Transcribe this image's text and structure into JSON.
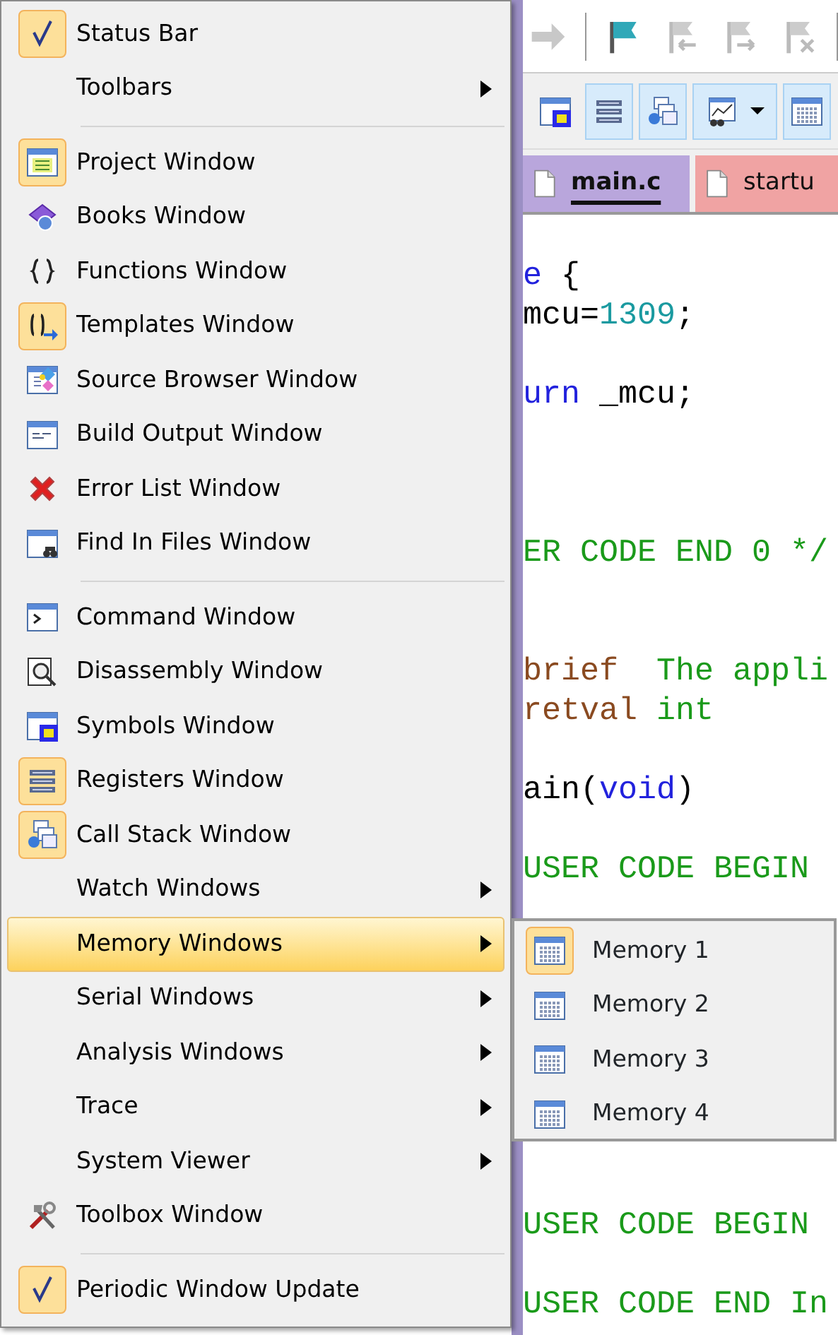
{
  "toolbar": {
    "buttons": [
      {
        "on": false
      },
      {
        "on": false
      },
      {
        "on": false
      },
      {
        "on": false
      },
      {
        "on": false
      }
    ]
  },
  "toolbar_2": {
    "buttons": [
      {
        "on": false
      },
      {
        "on": true
      },
      {
        "on": true
      },
      {
        "on": true
      },
      {
        "on": true
      }
    ]
  },
  "tabs": [
    {
      "label": "main.c",
      "selected": true,
      "color": "#b9a6dc"
    },
    {
      "label": "startu",
      "selected": false,
      "color": "#f0a3a3"
    }
  ],
  "code": {
    "lines": [
      {
        "kind": "code",
        "segments": [
          {
            "kind": "keyword",
            "text": "e"
          },
          {
            "kind": "plain",
            "text": " {"
          }
        ]
      },
      {
        "kind": "code",
        "segments": [
          {
            "kind": "plain",
            "text": "mcu="
          },
          {
            "kind": "number",
            "text": "1309"
          },
          {
            "kind": "plain",
            "text": ";"
          }
        ]
      },
      {
        "kind": "blank"
      },
      {
        "kind": "code",
        "segments": [
          {
            "kind": "keyword",
            "text": "urn"
          },
          {
            "kind": "plain",
            "text": " _mcu;"
          }
        ]
      },
      {
        "kind": "blank"
      },
      {
        "kind": "blank"
      },
      {
        "kind": "blank"
      },
      {
        "kind": "code",
        "segments": [
          {
            "kind": "comment",
            "text": "ER CODE END 0 */"
          }
        ]
      },
      {
        "kind": "blank"
      },
      {
        "kind": "blank"
      },
      {
        "kind": "code",
        "segments": [
          {
            "kind": "tag",
            "text": "brief"
          },
          {
            "kind": "comment",
            "text": "  The appli"
          }
        ]
      },
      {
        "kind": "code",
        "segments": [
          {
            "kind": "tag",
            "text": "retval"
          },
          {
            "kind": "comment",
            "text": " int"
          }
        ]
      },
      {
        "kind": "blank"
      },
      {
        "kind": "code",
        "segments": [
          {
            "kind": "plain",
            "text": "ain("
          },
          {
            "kind": "keyword",
            "text": "void"
          },
          {
            "kind": "plain",
            "text": ")"
          }
        ]
      },
      {
        "kind": "blank"
      },
      {
        "kind": "code",
        "segments": [
          {
            "kind": "comment",
            "text": "USER CODE BEGIN"
          }
        ]
      },
      {
        "kind": "blank"
      },
      {
        "kind": "blank"
      },
      {
        "kind": "blank"
      },
      {
        "kind": "blank"
      },
      {
        "kind": "blank"
      },
      {
        "kind": "blank"
      },
      {
        "kind": "blank"
      },
      {
        "kind": "blank"
      },
      {
        "kind": "code",
        "segments": [
          {
            "kind": "comment",
            "text": "USER CODE BEGIN"
          }
        ]
      },
      {
        "kind": "blank"
      },
      {
        "kind": "code",
        "segments": [
          {
            "kind": "comment",
            "text": "USER CODE END In"
          }
        ]
      }
    ]
  },
  "menu": {
    "items": [
      {
        "kind": "check",
        "label": "Status Bar",
        "checked": true,
        "submenu": false,
        "selected": false
      },
      {
        "kind": "command",
        "label": "Toolbars",
        "on": false,
        "submenu": true,
        "selected": false
      },
      {
        "kind": "separator"
      },
      {
        "kind": "command",
        "label": "Project Window",
        "on": true,
        "submenu": false,
        "selected": false
      },
      {
        "kind": "command",
        "label": "Books Window",
        "on": false,
        "submenu": false,
        "selected": false
      },
      {
        "kind": "command",
        "label": "Functions Window",
        "on": false,
        "submenu": false,
        "selected": false
      },
      {
        "kind": "command",
        "label": "Templates Window",
        "on": true,
        "submenu": false,
        "selected": false
      },
      {
        "kind": "command",
        "label": "Source Browser Window",
        "on": false,
        "submenu": false,
        "selected": false
      },
      {
        "kind": "command",
        "label": "Build Output Window",
        "on": false,
        "submenu": false,
        "selected": false
      },
      {
        "kind": "command",
        "label": "Error List Window",
        "on": false,
        "submenu": false,
        "selected": false
      },
      {
        "kind": "command",
        "label": "Find In Files Window",
        "on": false,
        "submenu": false,
        "selected": false
      },
      {
        "kind": "separator"
      },
      {
        "kind": "command",
        "label": "Command Window",
        "on": false,
        "submenu": false,
        "selected": false
      },
      {
        "kind": "command",
        "label": "Disassembly Window",
        "on": false,
        "submenu": false,
        "selected": false
      },
      {
        "kind": "command",
        "label": "Symbols Window",
        "on": false,
        "submenu": false,
        "selected": false
      },
      {
        "kind": "command",
        "label": "Registers Window",
        "on": true,
        "submenu": false,
        "selected": false
      },
      {
        "kind": "command",
        "label": "Call Stack Window",
        "on": true,
        "submenu": false,
        "selected": false
      },
      {
        "kind": "command",
        "label": "Watch Windows",
        "on": false,
        "submenu": true,
        "selected": false
      },
      {
        "kind": "command",
        "label": "Memory Windows",
        "on": false,
        "submenu": true,
        "selected": true
      },
      {
        "kind": "command",
        "label": "Serial Windows",
        "on": false,
        "submenu": true,
        "selected": false
      },
      {
        "kind": "command",
        "label": "Analysis Windows",
        "on": false,
        "submenu": true,
        "selected": false
      },
      {
        "kind": "command",
        "label": "Trace",
        "on": false,
        "submenu": true,
        "selected": false
      },
      {
        "kind": "command",
        "label": "System Viewer",
        "on": false,
        "submenu": true,
        "selected": false
      },
      {
        "kind": "command",
        "label": "Toolbox Window",
        "on": false,
        "submenu": false,
        "selected": false
      },
      {
        "kind": "separator"
      },
      {
        "kind": "check",
        "label": "Periodic Window Update",
        "checked": true,
        "submenu": false,
        "selected": false
      }
    ]
  },
  "submenu": {
    "items": [
      {
        "label": "Memory 1",
        "on": true,
        "selected": false
      },
      {
        "label": "Memory 2",
        "on": false,
        "selected": false
      },
      {
        "label": "Memory 3",
        "on": false,
        "selected": false
      },
      {
        "label": "Memory 4",
        "on": false,
        "selected": false
      }
    ]
  }
}
